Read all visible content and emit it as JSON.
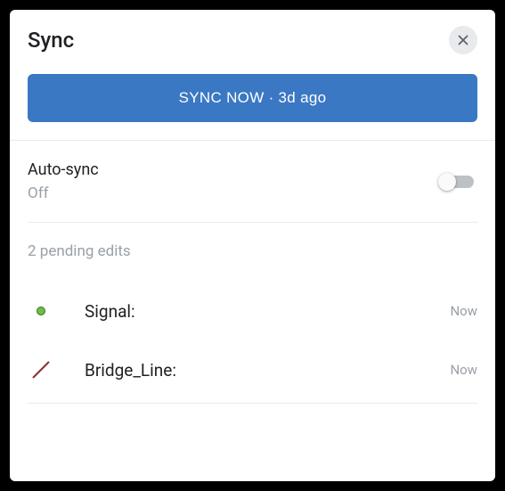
{
  "header": {
    "title": "Sync"
  },
  "syncButton": {
    "label": "SYNC NOW · 3d ago"
  },
  "autoSync": {
    "label": "Auto-sync",
    "status": "Off",
    "enabled": false
  },
  "pending": {
    "countLabel": "2 pending edits",
    "items": [
      {
        "name": "Signal:",
        "time": "Now",
        "iconType": "point"
      },
      {
        "name": "Bridge_Line:",
        "time": "Now",
        "iconType": "line"
      }
    ]
  }
}
